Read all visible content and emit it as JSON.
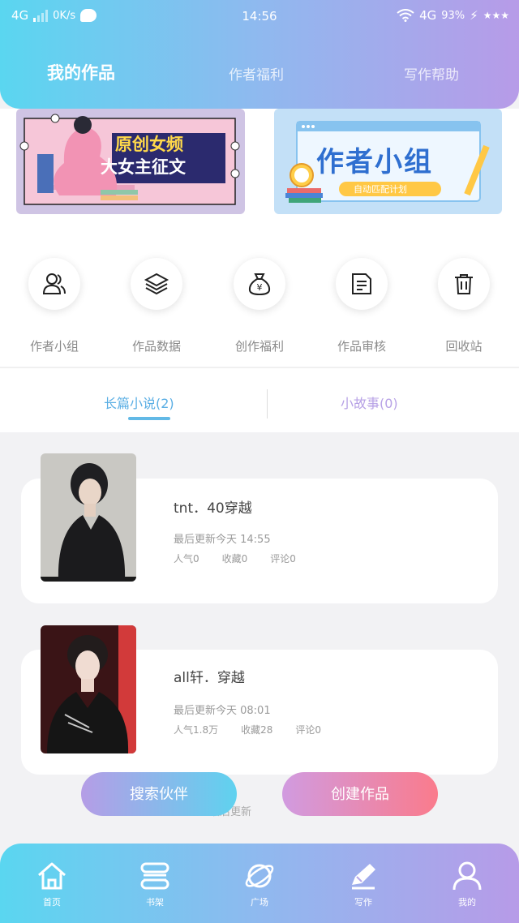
{
  "status_bar": {
    "network": "4G",
    "speed": "0K/s",
    "time": "14:56",
    "right_network": "4G",
    "battery": "93%",
    "extra": "★★★"
  },
  "header": {
    "tabs": [
      {
        "label": "我的作品",
        "active": true
      },
      {
        "label": "作者福利",
        "active": false
      },
      {
        "label": "写作帮助",
        "active": false
      }
    ],
    "colors": {
      "gradient_start": "#5ad6f0",
      "gradient_end": "#b79be8"
    }
  },
  "banners": {
    "left": {
      "line1": "原创女频",
      "line2": "大女主征文"
    },
    "right": {
      "title": "作者小组",
      "subtitle": "自动匹配计划"
    }
  },
  "quick_actions": [
    {
      "label": "作者小组",
      "icon": "users-icon"
    },
    {
      "label": "作品数据",
      "icon": "layers-icon"
    },
    {
      "label": "创作福利",
      "icon": "money-bag-icon"
    },
    {
      "label": "作品审核",
      "icon": "document-icon"
    },
    {
      "label": "回收站",
      "icon": "trash-icon"
    }
  ],
  "subtabs": [
    {
      "label": "长篇小说(2)",
      "active": true
    },
    {
      "label": "小故事(0)",
      "active": false
    }
  ],
  "works": [
    {
      "title": "tnt．40穿越",
      "update": "最后更新今天 14:55",
      "popularity": "人气0",
      "favorites": "收藏0",
      "comments": "评论0"
    },
    {
      "title": "all轩．穿越",
      "update": "最后更新今天 08:01",
      "popularity": "人气1.8万",
      "favorites": "收藏28",
      "comments": "评论0"
    }
  ],
  "actions": {
    "partner": "搜索伙伴",
    "create": "创建作品",
    "hint": "最后更新"
  },
  "bottom_nav": [
    {
      "label": "首页",
      "icon": "home-icon"
    },
    {
      "label": "书架",
      "icon": "bookshelf-icon"
    },
    {
      "label": "广场",
      "icon": "planet-icon"
    },
    {
      "label": "写作",
      "icon": "pen-icon"
    },
    {
      "label": "我的",
      "icon": "user-icon"
    }
  ]
}
